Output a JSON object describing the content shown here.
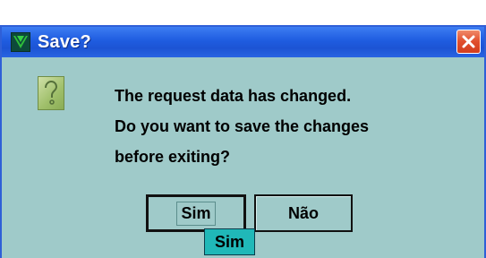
{
  "dialog": {
    "title": "Save?",
    "icon": "question-icon",
    "message_lines": [
      "The request data has changed.",
      "Do you want to save the changes",
      "before exiting?"
    ],
    "buttons": {
      "yes_label": "Sim",
      "no_label": "Não"
    },
    "tooltip": "Sim"
  },
  "colors": {
    "titlebar": "#1f5ce0",
    "body_background": "#9fcac9",
    "close_button": "#e04e2c",
    "tooltip_background": "#20b8b8"
  }
}
